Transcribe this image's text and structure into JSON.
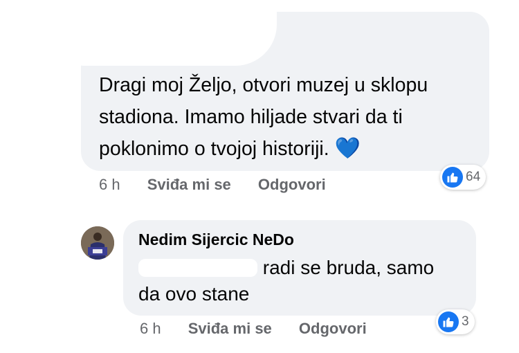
{
  "comment1": {
    "text_line1": "Dragi moj Željo, otvori muzej u sklopu",
    "text_line2": "stadiona. Imamo hiljade stvari da ti",
    "text_line3": "poklonimo o tvojoj historiji.",
    "emoji": "💙",
    "time": "6 h",
    "like_label": "Sviđa mi se",
    "reply_label": "Odgovori",
    "reaction_count": "64"
  },
  "comment2": {
    "author": "Nedim Sijercic NeDo",
    "text_tail_line1": "radi se bruda, samo",
    "text_line2": "da ovo stane",
    "time": "6 h",
    "like_label": "Sviđa mi se",
    "reply_label": "Odgovori",
    "reaction_count": "3"
  },
  "colors": {
    "bubble": "#f0f2f5",
    "meta": "#65676b",
    "accent": "#1877f2"
  },
  "icons": {
    "reaction": "like-thumb-icon",
    "avatar": "user-avatar"
  }
}
